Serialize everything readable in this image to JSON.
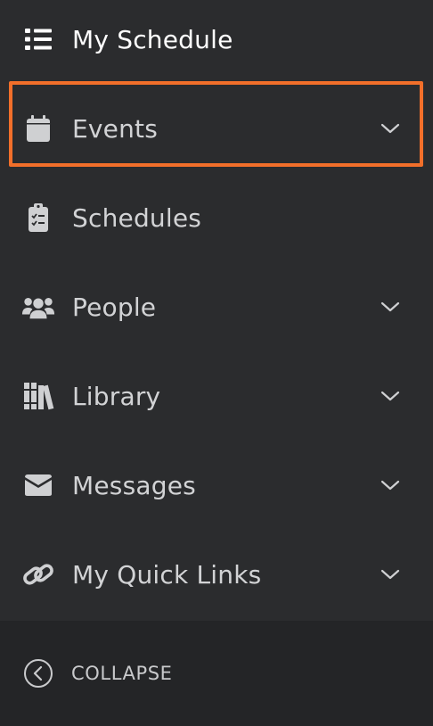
{
  "sidebar": {
    "items": [
      {
        "label": "My Schedule",
        "icon": "list-icon",
        "has_chevron": false,
        "active": true
      },
      {
        "label": "Events",
        "icon": "calendar-icon",
        "has_chevron": true,
        "highlighted": true
      },
      {
        "label": "Schedules",
        "icon": "clipboard-icon",
        "has_chevron": false
      },
      {
        "label": "People",
        "icon": "users-icon",
        "has_chevron": true
      },
      {
        "label": "Library",
        "icon": "books-icon",
        "has_chevron": true
      },
      {
        "label": "Messages",
        "icon": "envelope-icon",
        "has_chevron": true
      },
      {
        "label": "My Quick Links",
        "icon": "link-icon",
        "has_chevron": true
      }
    ]
  },
  "footer": {
    "collapse_label": "COLLAPSE",
    "icon": "chevron-left-circle-icon"
  },
  "colors": {
    "background": "#2b2c2e",
    "footer_background": "#242527",
    "highlight": "#f26f2a",
    "text": "#d2d3d5"
  }
}
